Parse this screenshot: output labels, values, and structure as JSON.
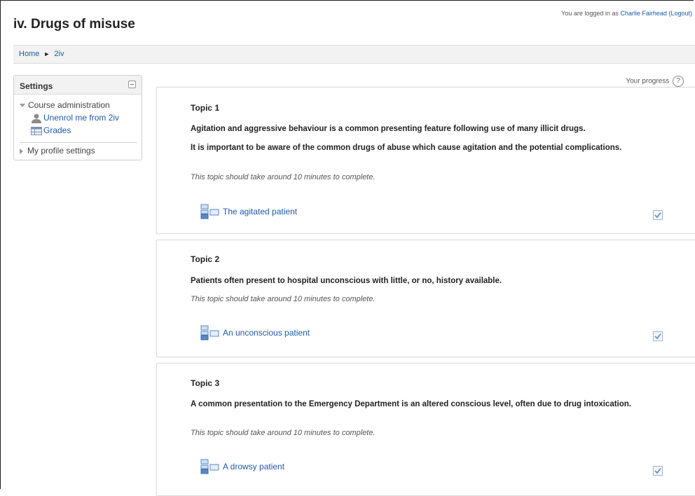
{
  "header": {
    "login_prefix": "You are logged in as",
    "user_name": "Charlie Fairhead",
    "logout_label": "(Logout)",
    "page_title": "iv. Drugs of misuse"
  },
  "breadcrumb": {
    "home": "Home",
    "separator": "►",
    "course": "2iv"
  },
  "settings_block": {
    "title": "Settings",
    "course_admin": "Course administration",
    "unenrol": "Unenrol me from 2iv",
    "grades": "Grades",
    "profile_settings": "My profile settings"
  },
  "progress": {
    "label": "Your progress",
    "help": "?"
  },
  "topics": [
    {
      "title": "Topic 1",
      "text1": "Agitation and aggressive behaviour is a common presenting feature following use of many illicit drugs.",
      "text2": "It is important to be aware of the common drugs of abuse which cause agitation and the potential complications.",
      "note": "This topic should take around 10 minutes to complete.",
      "activity": "The agitated patient"
    },
    {
      "title": "Topic 2",
      "text1": "Patients often present to hospital unconscious with little, or no, history available.",
      "note": "This topic should take around 10 minutes to complete.",
      "activity": "An unconscious patient"
    },
    {
      "title": "Topic 3",
      "text1": "A common presentation to the Emergency Department is an altered conscious level, often due to drug intoxication.",
      "note": "This topic should take around 10 minutes to complete.",
      "activity": "A drowsy patient"
    }
  ],
  "colors": {
    "link": "#1d5aa8",
    "navbar_bg": "#f2f2f2",
    "check": "#6b8fc4"
  }
}
